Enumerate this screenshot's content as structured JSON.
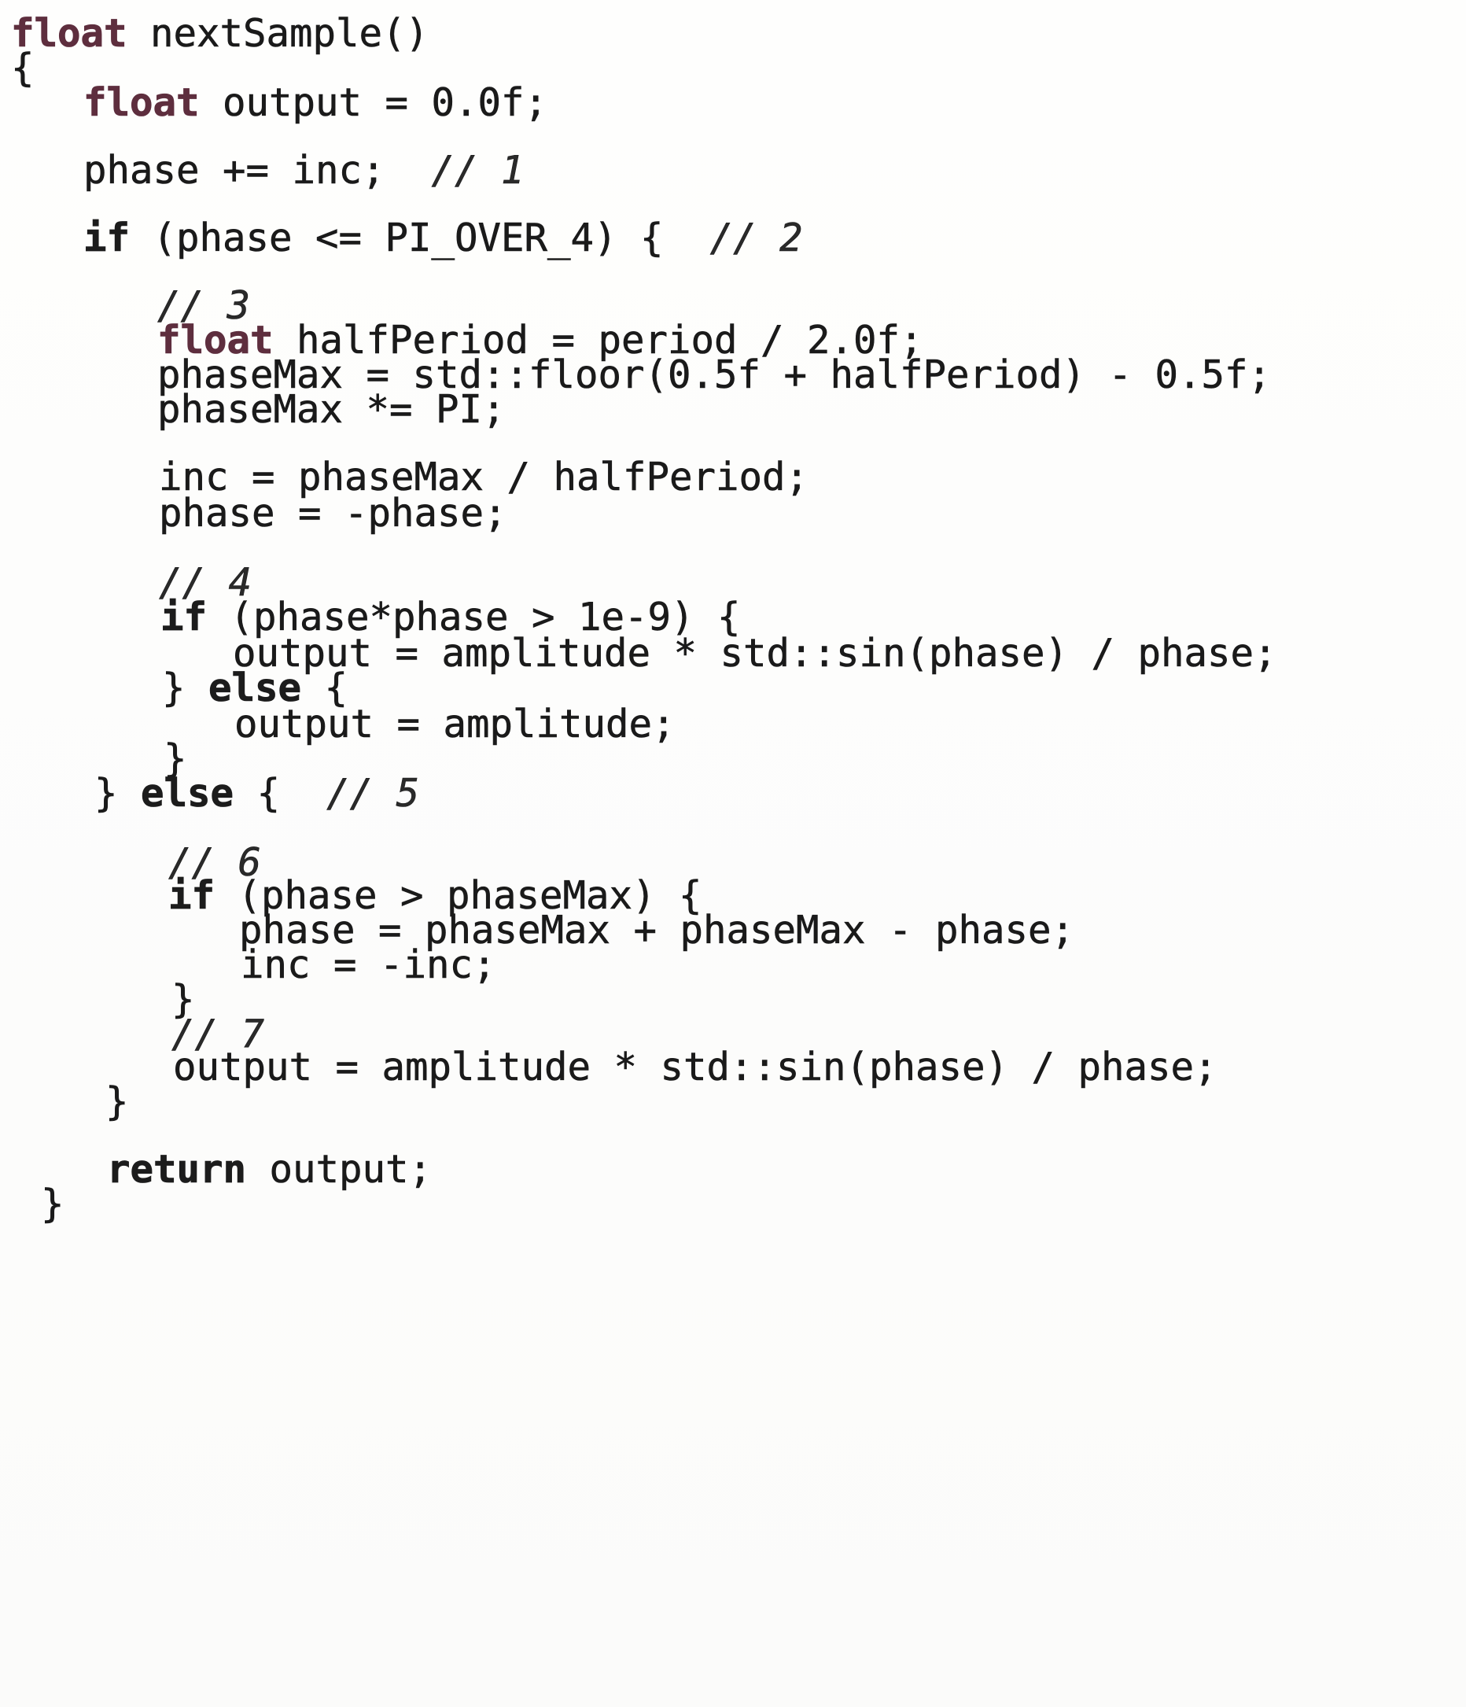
{
  "code": {
    "signature": {
      "type": "float",
      "name": "nextSample()"
    },
    "open_brace": "{",
    "line_output_decl": {
      "type": "float",
      "rest": "output = 0.0f;"
    },
    "line_phase_inc": {
      "code": "phase += inc;",
      "comment": "// 1"
    },
    "line_if1": {
      "keyword": "if",
      "rest": "(phase <= PI_OVER_4) {",
      "comment": "// 2"
    },
    "comment_3": "// 3",
    "line_halfperiod": {
      "type": "float",
      "rest": "halfPeriod = period / 2.0f;"
    },
    "line_phasemax_floor": "phaseMax = std::floor(0.5f + halfPeriod) - 0.5f;",
    "line_phasemax_pi": "phaseMax *= PI;",
    "line_inc_assign": "inc = phaseMax / halfPeriod;",
    "line_phase_neg": "phase = -phase;",
    "comment_4": "// 4",
    "line_if2": {
      "keyword": "if",
      "rest": "(phase*phase > 1e-9) {"
    },
    "line_output_sin1": "output = amplitude * std::sin(phase) / phase;",
    "line_else_inner": {
      "close": "}",
      "keyword": "else",
      "open": "{"
    },
    "line_output_amp": "output = amplitude;",
    "close_inner": "}",
    "line_else_outer": {
      "close": "}",
      "keyword": "else",
      "open": "{",
      "comment": "// 5"
    },
    "comment_6": "// 6",
    "line_if3": {
      "keyword": "if",
      "rest": "(phase > phaseMax) {"
    },
    "line_phase_reflect": "phase = phaseMax + phaseMax - phase;",
    "line_inc_neg": "inc = -inc;",
    "close_if3": "}",
    "comment_7": "// 7",
    "line_output_sin2": "output = amplitude * std::sin(phase) / phase;",
    "close_else": "}",
    "line_return": {
      "keyword": "return",
      "rest": "output;"
    },
    "close_fn": "}"
  }
}
